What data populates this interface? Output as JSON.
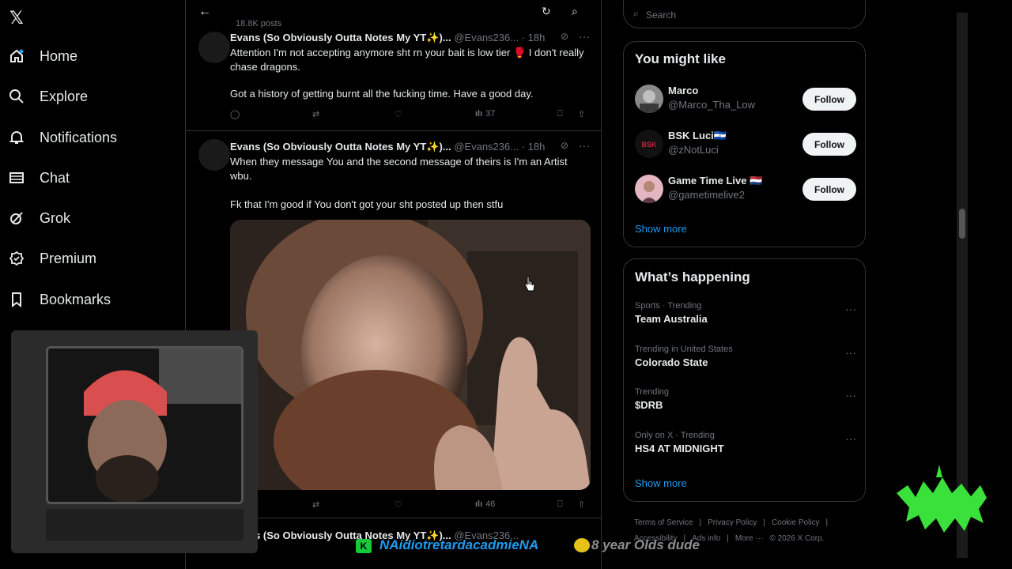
{
  "nav": {
    "logo": "𝕏",
    "items": [
      {
        "label": "Home",
        "icon": "home-icon"
      },
      {
        "label": "Explore",
        "icon": "search-icon"
      },
      {
        "label": "Notifications",
        "icon": "bell-icon"
      },
      {
        "label": "Chat",
        "icon": "mail-icon"
      },
      {
        "label": "Grok",
        "icon": "grok-icon"
      },
      {
        "label": "Premium",
        "icon": "premium-icon"
      },
      {
        "label": "Bookmarks",
        "icon": "bookmark-icon"
      }
    ]
  },
  "header": {
    "post_count": "18.8K posts"
  },
  "tweets": [
    {
      "name": "Evans (So Obviously Outta Notes My YT✨)...",
      "handle": "@Evans236...",
      "time": "· 18h",
      "lines": [
        "Attention I'm not accepting anymore sht rn your bait is low tier 🥊 I don't really chase dragons.",
        "Got a history of getting burnt all the fucking time. Have a good day."
      ],
      "views": "37"
    },
    {
      "name": "Evans (So Obviously Outta Notes My YT✨)...",
      "handle": "@Evans236...",
      "time": "· 18h",
      "lines": [
        "When they message You and the second message of theirs is I'm an Artist wbu.",
        "Fk that I'm good if You don't got your sht posted up then stfu"
      ],
      "views": "46"
    },
    {
      "name": "Evans (So Obviously Outta Notes My YT✨)...",
      "handle": "@Evans236..."
    }
  ],
  "search": {
    "placeholder": "Search"
  },
  "you_might_like": {
    "title": "You might like",
    "users": [
      {
        "name": "Marco",
        "handle": "@Marco_Tha_Low",
        "button": "Follow"
      },
      {
        "name": "BSK Luci🇸🇻",
        "handle": "@zNotLuci",
        "button": "Follow"
      },
      {
        "name": "Game Time Live 🇳🇱",
        "handle": "@gametimelive2",
        "button": "Follow"
      }
    ],
    "show_more": "Show more"
  },
  "whats_happening": {
    "title": "What’s happening",
    "trends": [
      {
        "context": "Sports · Trending",
        "topic": "Team Australia"
      },
      {
        "context": "Trending in United States",
        "topic": "Colorado State"
      },
      {
        "context": "Trending",
        "topic": "$DRB"
      },
      {
        "context": "Only on X · Trending",
        "topic": "HS4 AT MIDNIGHT"
      }
    ],
    "show_more": "Show more"
  },
  "footer": {
    "links": [
      "Terms of Service",
      "|",
      "Privacy Policy",
      "|",
      "Cookie Policy",
      "|",
      "Accessibility",
      "|",
      "Ads info",
      "|",
      "More ···",
      "© 2026 X Corp."
    ]
  },
  "stream_overlay": {
    "badge": "K",
    "username": "NAidiotretardacadmieNA",
    "message": "8 year Olds dude"
  },
  "colors": {
    "background": "#000000",
    "accent": "#1d9bf0",
    "text": "#e7e9ea",
    "muted": "#71767b",
    "border": "#2f3336"
  }
}
